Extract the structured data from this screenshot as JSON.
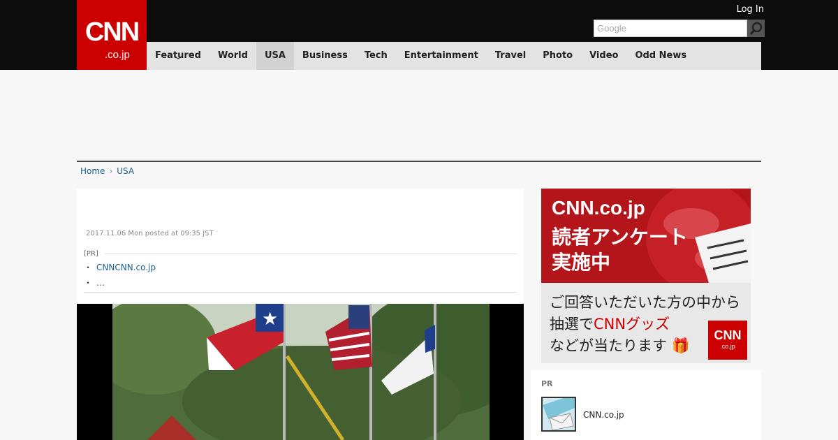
{
  "header": {
    "logo_text": "CNN",
    "logo_sub": ".co.jp",
    "login": "Log In",
    "search_placeholder": "Google"
  },
  "nav": {
    "items": [
      "Featured",
      "World",
      "USA",
      "Business",
      "Tech",
      "Entertainment",
      "Travel",
      "Photo",
      "Video",
      "Odd News"
    ],
    "active": "USA"
  },
  "breadcrumb": {
    "home": "Home",
    "current": "USA"
  },
  "article": {
    "date": "2017.11.06 Mon posted at 09:35 JST",
    "pr_label": "[PR]",
    "pr_links": [
      "CNNCNN.co.jp",
      "…"
    ]
  },
  "side_banner": {
    "line1": "CNN.co.jp",
    "line2": "読者アンケート",
    "line3": "実施中",
    "sub1": "ご回答いただいた方の中から",
    "sub2_a": "抽選で",
    "sub2_b": "CNNグッズ",
    "sub3": "などが当たります",
    "badge": "CNN",
    "badge_sub": ".co.jp"
  },
  "pr_box": {
    "label": "PR",
    "text": "CNN.co.jp"
  },
  "colors": {
    "brand": "#cc0000",
    "link": "#1a5d8f",
    "topbar": "#0c0c0c"
  }
}
